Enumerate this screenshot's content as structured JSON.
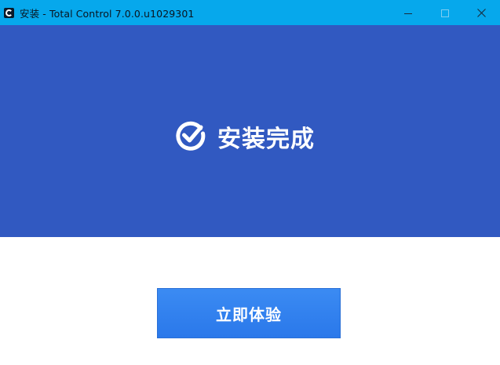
{
  "window": {
    "title": "安装 - Total Control 7.0.0.u1029301"
  },
  "icons": {
    "app": "app-logo-icon",
    "minimize": "minimize-icon",
    "maximize": "maximize-icon",
    "close": "close-icon",
    "check": "check-circle-icon"
  },
  "hero": {
    "status_text": "安装完成"
  },
  "actions": {
    "primary_label": "立即体验"
  },
  "colors": {
    "titlebar": "#06a8ec",
    "hero_background": "#3159c1",
    "button": "#2f80ed",
    "text_on_dark": "#ffffff"
  }
}
